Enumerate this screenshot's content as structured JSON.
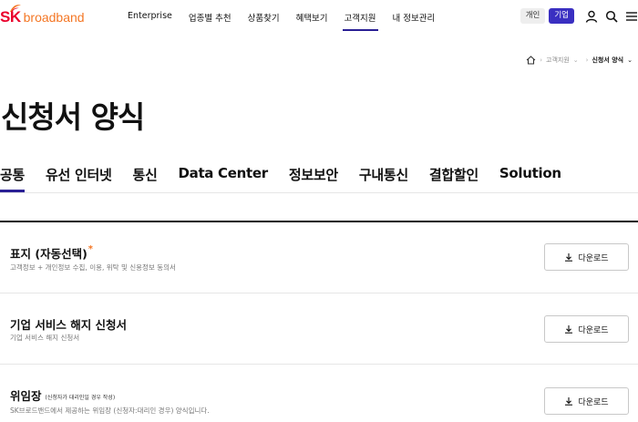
{
  "brand": {
    "sk": "SK",
    "name": "broadband",
    "accent": "#ea002c",
    "orange": "#f47725",
    "navy": "#2a1f95"
  },
  "gnb": {
    "items": [
      {
        "label": "Enterprise",
        "active": false
      },
      {
        "label": "업종별 추천",
        "active": false
      },
      {
        "label": "상품찾기",
        "active": false
      },
      {
        "label": "혜택보기",
        "active": false
      },
      {
        "label": "고객지원",
        "active": true
      },
      {
        "label": "내 정보관리",
        "active": false
      }
    ]
  },
  "utils": {
    "personal_label": "개인",
    "business_label": "기업",
    "icons": [
      "user-icon",
      "search-icon",
      "menu-icon"
    ]
  },
  "breadcrumb": {
    "home_icon": "home-icon",
    "items": [
      "고객지원",
      "신청서 양식"
    ]
  },
  "page": {
    "title": "신청서 양식"
  },
  "tabs": [
    {
      "label": "공통",
      "active": true
    },
    {
      "label": "유선 인터넷",
      "active": false
    },
    {
      "label": "통신",
      "active": false
    },
    {
      "label": "Data Center",
      "active": false
    },
    {
      "label": "정보보안",
      "active": false
    },
    {
      "label": "구내통신",
      "active": false
    },
    {
      "label": "결합할인",
      "active": false
    },
    {
      "label": "Solution",
      "active": false
    }
  ],
  "forms": [
    {
      "title": "표지 (자동선택)",
      "required_mark": "*",
      "note": "",
      "desc": "고객정보 + 개인정보 수집, 이용, 위탁 및 신용정보 동의서",
      "button": "다운로드"
    },
    {
      "title": "기업 서비스 해지 신청서",
      "required_mark": "",
      "note": "",
      "desc": "기업 서비스 해지 신청서",
      "button": "다운로드"
    },
    {
      "title": "위임장",
      "required_mark": "",
      "note": "(신청자가 대리인일 경우 작성)",
      "desc": "SK브로드밴드에서 제공하는 위임장 (신청자:대리인 경우) 양식입니다.",
      "button": "다운로드"
    }
  ]
}
